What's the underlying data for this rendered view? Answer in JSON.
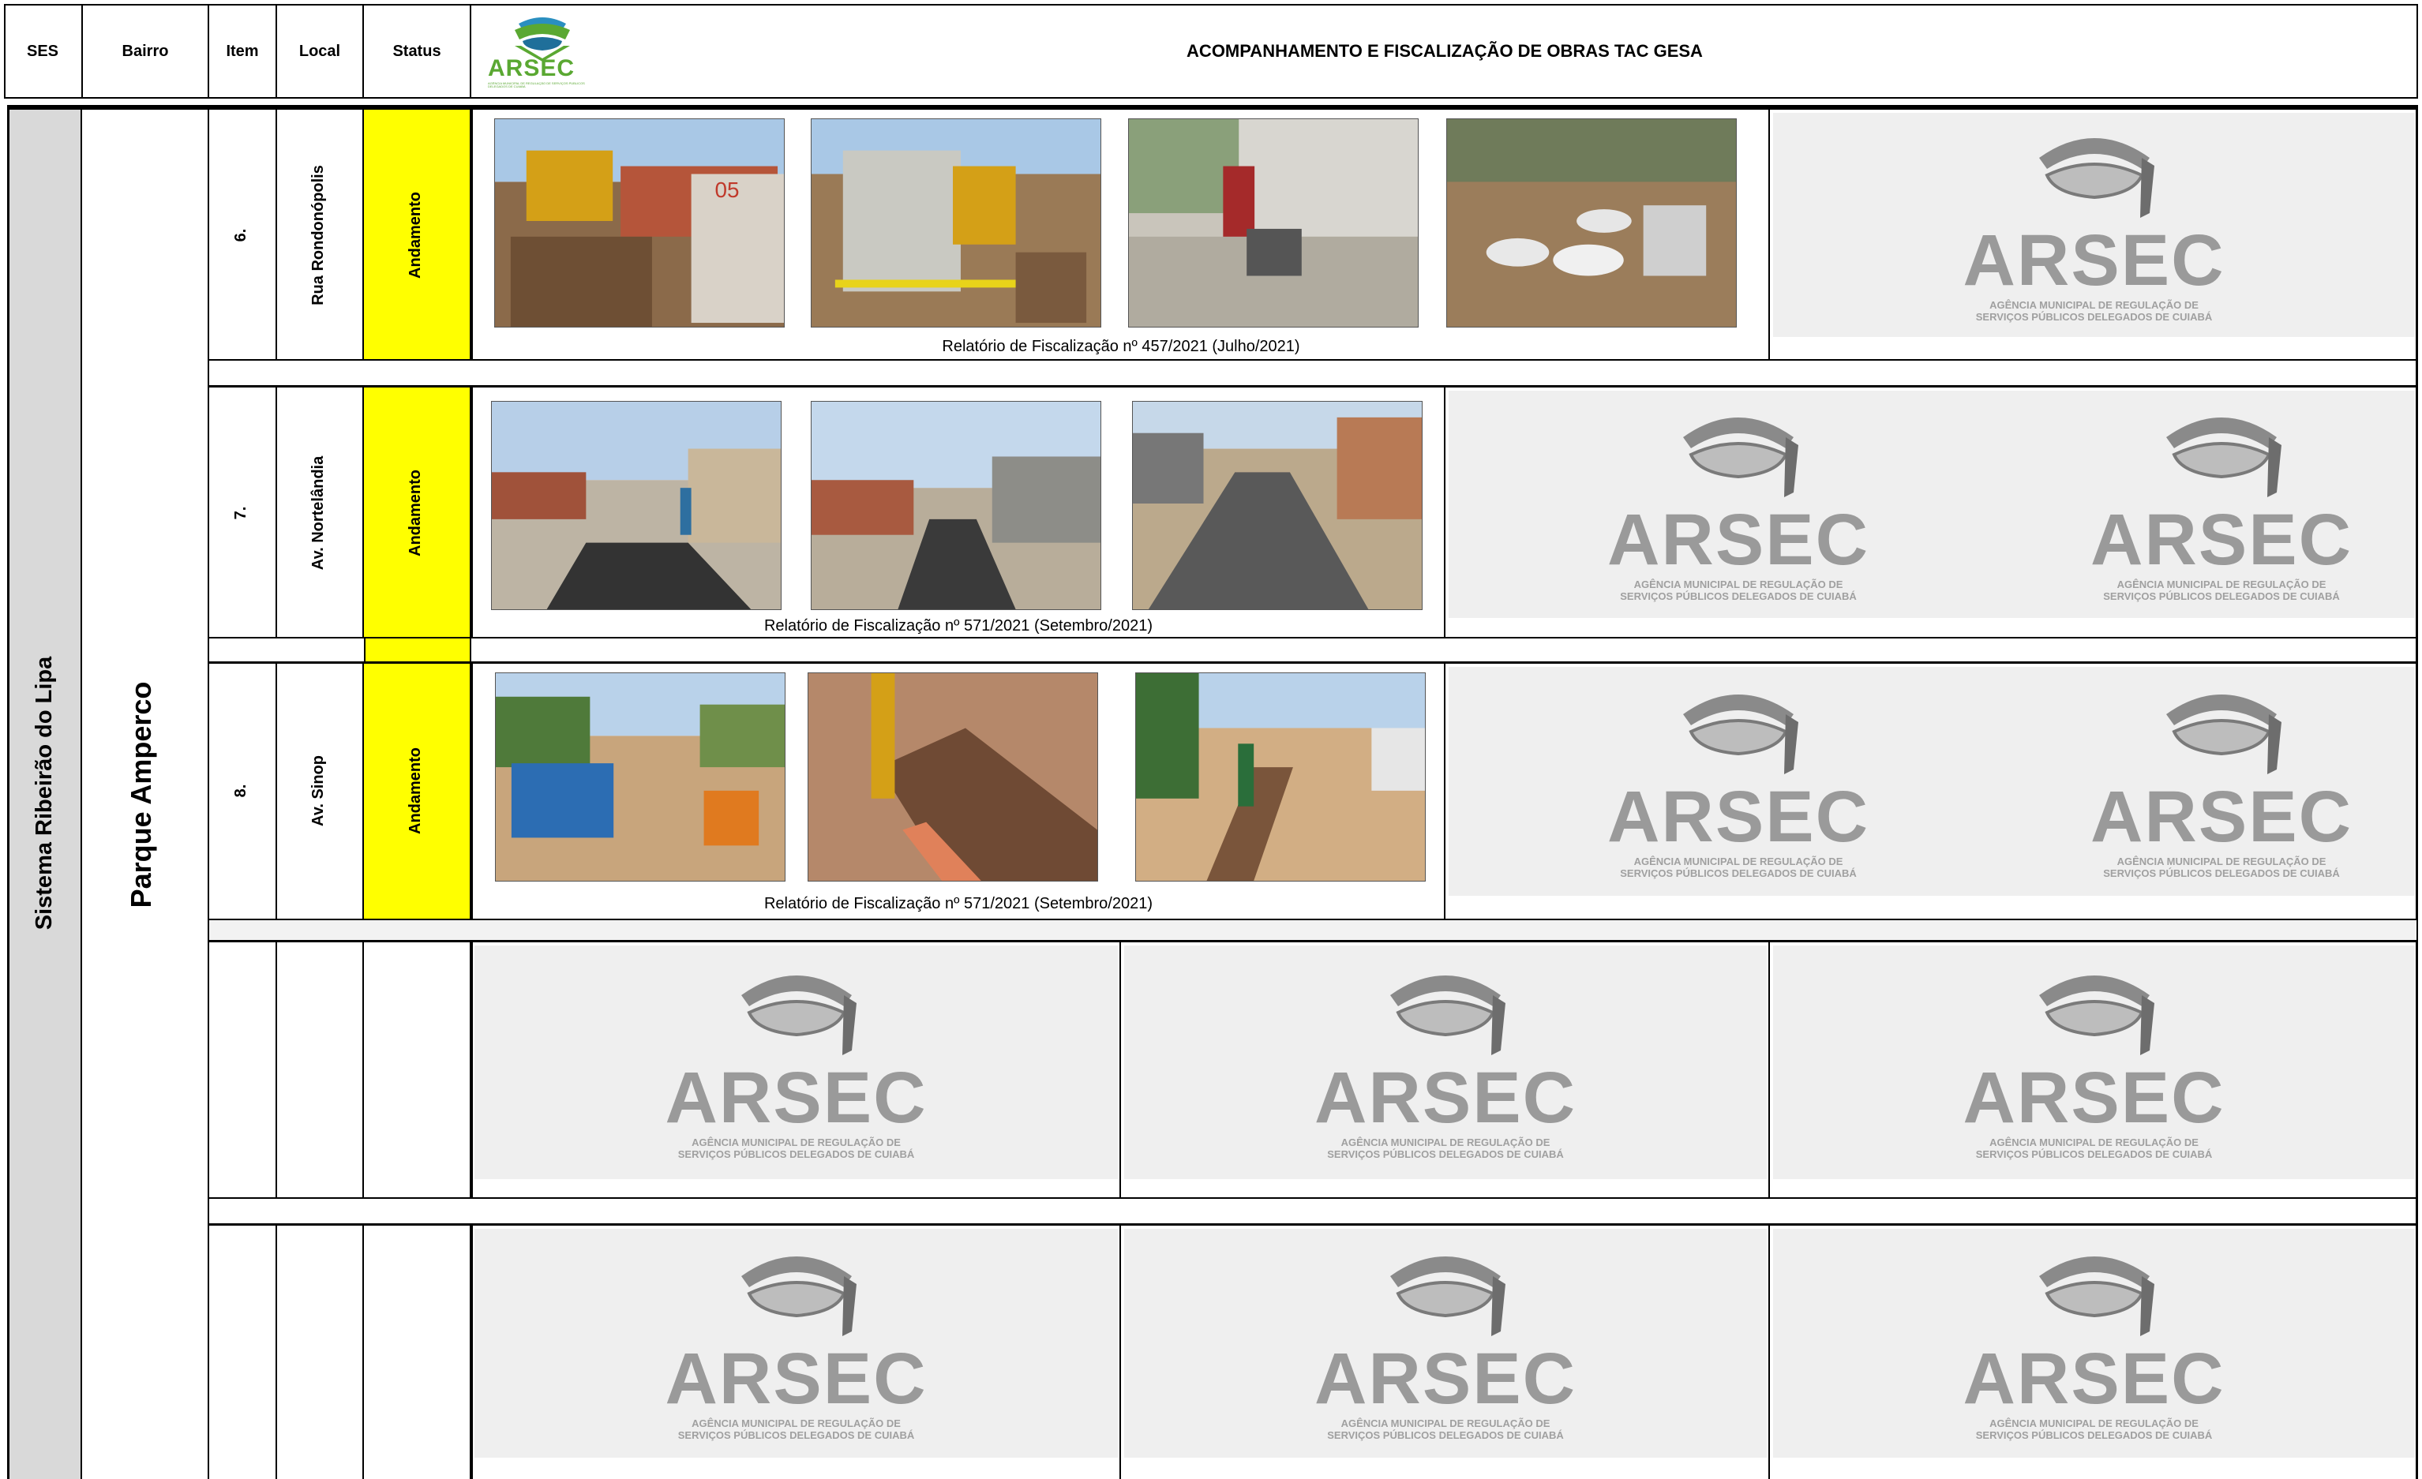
{
  "header": {
    "col_ses": "SES",
    "col_bairro": "Bairro",
    "col_item": "Item",
    "col_local": "Local",
    "col_status": "Status",
    "title": "ACOMPANHAMENTO E FISCALIZAÇÃO DE OBRAS TAC GESA",
    "logo_text": "ARSEC",
    "logo_subtext": "AGÊNCIA MUNICIPAL DE REGULAÇÃO DE SERVIÇOS PÚBLICOS DELEGADOS DE CUIABÁ"
  },
  "ses": "Sistema Ribeirão do Lipa",
  "bairro": "Parque Amperco",
  "rows": [
    {
      "item": "6.",
      "local": "Rua Rondonópolis",
      "status": "Andamento",
      "caption": "Relatório de Fiscalização nº 457/2021 (Julho/2021)",
      "photos": [
        "backhoe-excavation-photo",
        "trench-shoring-photo",
        "pavement-cutting-photo",
        "pipe-fittings-photo"
      ]
    },
    {
      "item": "7.",
      "local": "Av. Nortelândia",
      "status": "Andamento",
      "caption": "Relatório de Fiscalização nº 571/2021 (Setembro/2021)",
      "photos": [
        "asphalt-repair-photo",
        "street-paving-photo",
        "paved-street-photo"
      ]
    },
    {
      "item": "8.",
      "local": "Av. Sinop",
      "status": "Andamento",
      "caption": "Relatório de Fiscalização nº 571/2021 (Setembro/2021)",
      "photos": [
        "work-zone-sign-photo",
        "trench-pipe-photo",
        "trench-street-photo"
      ]
    }
  ],
  "watermark": {
    "text": "ARSEC",
    "line1": "AGÊNCIA MUNICIPAL DE REGULAÇÃO DE",
    "line2": "SERVIÇOS PÚBLICOS DELEGADOS DE CUIABÁ"
  },
  "colors": {
    "status_fill": "#ffff00",
    "watermark_bg": "#efefef",
    "logo_green": "#5aa832",
    "logo_blue": "#2a8fc0"
  }
}
